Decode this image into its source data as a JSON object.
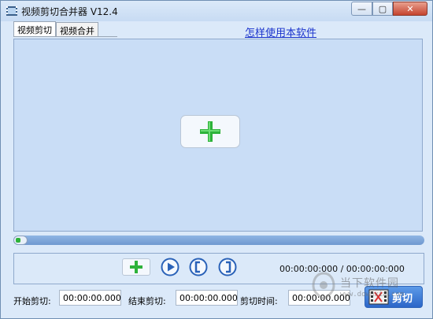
{
  "window": {
    "title": "视频剪切合并器 V12.4",
    "buttons": {
      "minimize": "—",
      "maximize": "▢",
      "close": "✕"
    }
  },
  "tabs": [
    {
      "label": "视频剪切",
      "active": true
    },
    {
      "label": "视频合并",
      "active": false
    }
  ],
  "help_link": "怎样使用本软件",
  "controls": {
    "timecode": "00:00:00:000 / 00:00:00:000",
    "icons": [
      "add-icon",
      "play-icon",
      "bracket-left-icon",
      "bracket-right-icon"
    ]
  },
  "progress": {
    "value": 0
  },
  "bottom": {
    "start_label": "开始剪切:",
    "start_value": "00:00:00.000",
    "end_label": "结束剪切:",
    "end_value": "00:00:00.000",
    "duration_label": "剪切时间:",
    "duration_value": "00:00:00.000",
    "cut_button": "剪切"
  },
  "watermark": {
    "text": "当下软件园",
    "url": "www.downxia.com"
  },
  "colors": {
    "accent": "#2db23a",
    "cut_button": "#2b66c8",
    "link": "#1a33cc"
  }
}
